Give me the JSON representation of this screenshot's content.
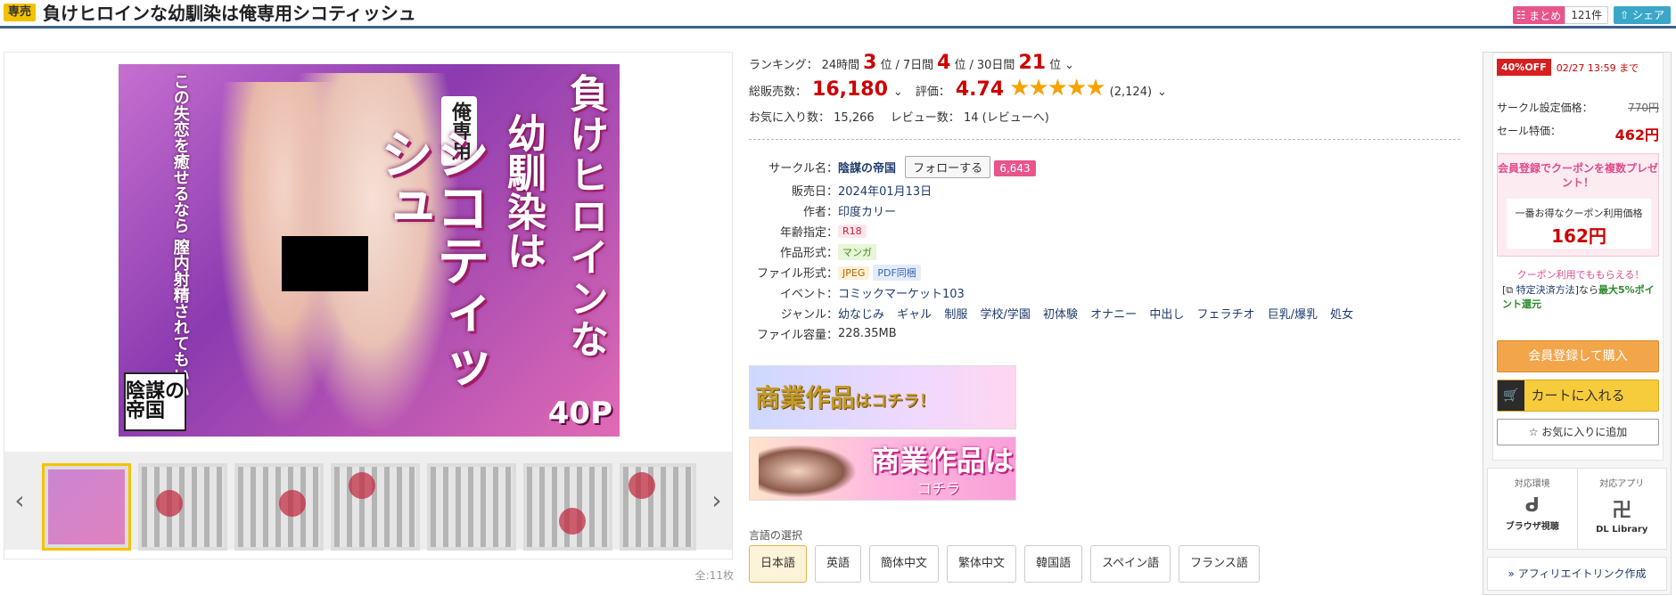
{
  "header": {
    "badge": "専売",
    "title": "負けヒロインな幼馴染は俺専用シコティッシュ",
    "matome_label": "まとめ",
    "matome_count": "121件",
    "share_label": "シェア"
  },
  "cover": {
    "text_line1": "負けヒロインな",
    "text_line2": "幼馴染は",
    "text_line3": "シコティッシュ",
    "text_tag": "俺専用",
    "text_sub": "この失恋を癒せるなら 膣内射精されてもいい―",
    "pages": "40P",
    "logo": "陰謀の帝国"
  },
  "gallery": {
    "prev_label": "‹",
    "next_label": "›",
    "total": "全:11枚"
  },
  "ranking": {
    "label": "ランキング：",
    "d24_label": "24時間",
    "d24_rank": "3",
    "d7_label": "7日間",
    "d7_rank": "4",
    "d30_label": "30日間",
    "d30_rank": "21",
    "unit": "位",
    "sep": "/"
  },
  "sales": {
    "label": "総販売数：",
    "value": "16,180",
    "rating_label": "評価：",
    "rating": "4.74",
    "stars": "★★★★★",
    "rating_count": "(2,124)"
  },
  "stats": {
    "fav_label": "お気に入り数：",
    "fav_value": "15,266",
    "review_label": "レビュー数：",
    "review_value": "14 (レビューへ)"
  },
  "spec": {
    "circle_label": "サークル名：",
    "circle": "陰謀の帝国",
    "follow": "フォローする",
    "follow_count": "6,643",
    "release_label": "販売日：",
    "release": "2024年01月13日",
    "author_label": "作者：",
    "author": "印度カリー",
    "age_label": "年齢指定：",
    "age": "R18",
    "form_label": "作品形式：",
    "form": "マンガ",
    "file_label": "ファイル形式：",
    "file1": "JPEG",
    "file2": "PDF同梱",
    "event_label": "イベント：",
    "event": "コミックマーケット103",
    "genre_label": "ジャンル：",
    "genres": [
      "幼なじみ",
      "ギャル",
      "制服",
      "学校/学園",
      "初体験",
      "オナニー",
      "中出し",
      "フェラチオ",
      "巨乳/爆乳",
      "処女"
    ],
    "size_label": "ファイル容量：",
    "size": "228.35MB"
  },
  "banners": {
    "b1_main": "商業作品",
    "b1_sub": "はコチラ！",
    "b2_main": "商業作品は",
    "b2_sub": "コチラ"
  },
  "language": {
    "label": "言語の選択",
    "options": [
      "日本語",
      "英語",
      "簡体中文",
      "繁体中文",
      "韓国語",
      "スペイン語",
      "フランス語"
    ]
  },
  "purchase": {
    "off_badge": "40%OFF",
    "until": "02/27 13:59 まで",
    "list_label": "サークル設定価格：",
    "list_price": "770円",
    "sale_label": "セール特価：",
    "sale_price": "462円",
    "coupon_title": "会員登録でクーポンを複数プレゼント！",
    "coupon_best_label": "一番お得なクーポン利用価格",
    "coupon_price": "162円",
    "coupon_note": "クーポン利用でももらえる！",
    "point_note_pre": "[",
    "point_link": "特定決済方法",
    "point_note_mid": "]なら",
    "point_strong": "最大5%ポイント還元",
    "buy_label": "会員登録して購入",
    "cart_label": "カートに入れる",
    "fav_label": "お気に入りに追加"
  },
  "env": {
    "env_label": "対応環境",
    "env_value": "ブラウザ視聴",
    "app_label": "対応アプリ",
    "app_value": "DL Library",
    "affiliate": "» アフィリエイトリンク作成"
  },
  "colors": {
    "accent_red": "#cc0000",
    "header_line": "#3a5f8a",
    "badge_yellow": "#f2c200",
    "pink": "#e8558b",
    "buy_orange": "#f3a54a",
    "cart_yellow": "#f7cc3c"
  }
}
